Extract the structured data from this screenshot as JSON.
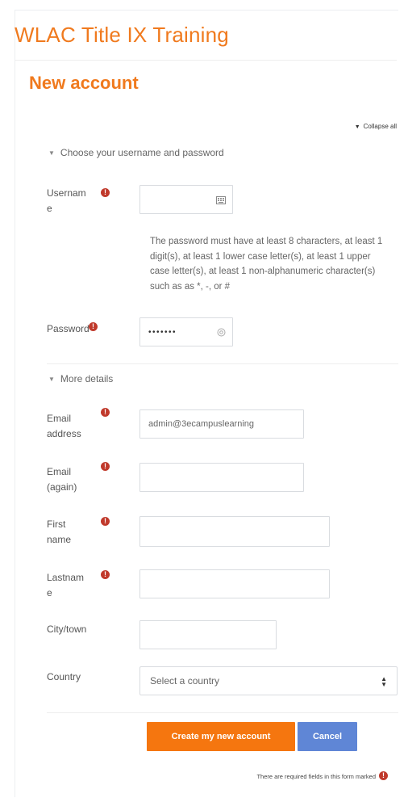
{
  "site": {
    "title": "WLAC Title IX Training"
  },
  "page": {
    "title": "New account"
  },
  "form": {
    "collapse_all": "Collapse all",
    "sections": {
      "credentials": "Choose your username and password",
      "details": "More details"
    },
    "username": {
      "label_line1": "Usernam",
      "label_line2": "e",
      "value": ""
    },
    "password_hint": "The password must have at least 8 characters, at least 1 digit(s), at least 1 lower case letter(s), at least 1 upper case letter(s), at least 1 non-alphanumeric character(s) such as as *, -, or #",
    "password": {
      "label": "Password",
      "value": "•••••••"
    },
    "email": {
      "label_line1": "Email",
      "label_line2": "address",
      "value": "admin@3ecampuslearning"
    },
    "email2": {
      "label_line1": "Email",
      "label_line2": "(again)",
      "value": ""
    },
    "firstname": {
      "label_line1": "First",
      "label_line2": "name",
      "value": ""
    },
    "lastname": {
      "label_line1": "Lastnam",
      "label_line2": "e",
      "value": ""
    },
    "city": {
      "label": "City/town",
      "value": ""
    },
    "country": {
      "label": "Country",
      "selected": "Select a country"
    },
    "buttons": {
      "submit": "Create my new account",
      "cancel": "Cancel"
    },
    "required_note": "There are required fields in this form marked"
  },
  "icons": {
    "required": "exclamation-circle-icon",
    "keyboard": "keyboard-icon",
    "reveal": "eye-icon",
    "caret": "sort-caret-icon",
    "collapse": "triangle-down-icon"
  },
  "colors": {
    "accent": "#f07a1e",
    "button_primary": "#f5760f",
    "button_cancel": "#5f86d6",
    "required": "#c0392b"
  }
}
